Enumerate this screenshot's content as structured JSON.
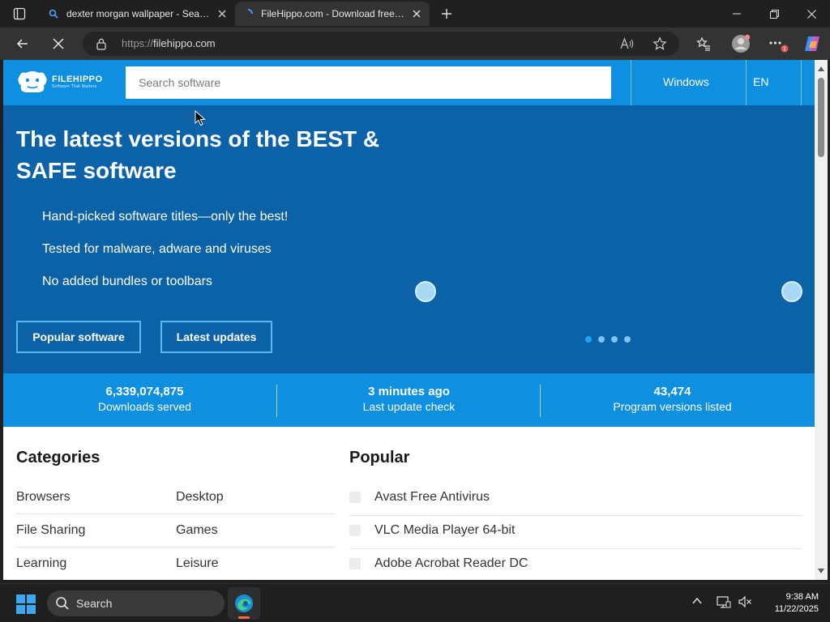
{
  "browser": {
    "tabs": [
      {
        "title": "dexter morgan wallpaper - Search",
        "active": false
      },
      {
        "title": "FileHippo.com - Download free so",
        "active": true
      }
    ],
    "url_prefix": "https://",
    "url_host": "filehippo.com"
  },
  "site": {
    "brand": "FILEHIPPO",
    "tagline": "Software That Matters",
    "search_placeholder": "Search software",
    "nav": {
      "windows": "Windows",
      "language": "EN"
    },
    "hero": {
      "title": "The latest versions of the BEST & SAFE software",
      "features": [
        "Hand-picked software titles—only the best!",
        "Tested for malware, adware and viruses",
        "No added bundles or toolbars"
      ],
      "buttons": {
        "popular": "Popular software",
        "latest": "Latest updates"
      },
      "carousel": {
        "slides": 4,
        "active": 1
      }
    },
    "stats": [
      {
        "value": "6,339,074,875",
        "label": "Downloads served"
      },
      {
        "value": "3 minutes ago",
        "label": "Last update check"
      },
      {
        "value": "43,474",
        "label": "Program versions listed"
      }
    ],
    "categories": {
      "title": "Categories",
      "items": [
        "Browsers",
        "Desktop",
        "File Sharing",
        "Games",
        "Learning",
        "Leisure"
      ]
    },
    "popular": {
      "title": "Popular",
      "items": [
        "Avast Free Antivirus",
        "VLC Media Player 64-bit",
        "Adobe Acrobat Reader DC"
      ]
    }
  },
  "taskbar": {
    "search_label": "Search",
    "time": "9:38 AM",
    "date": "11/22/2025"
  },
  "colors": {
    "header_blue": "#0e8fe0",
    "hero_blue": "#0b62a6",
    "dark_chrome": "#202020"
  }
}
